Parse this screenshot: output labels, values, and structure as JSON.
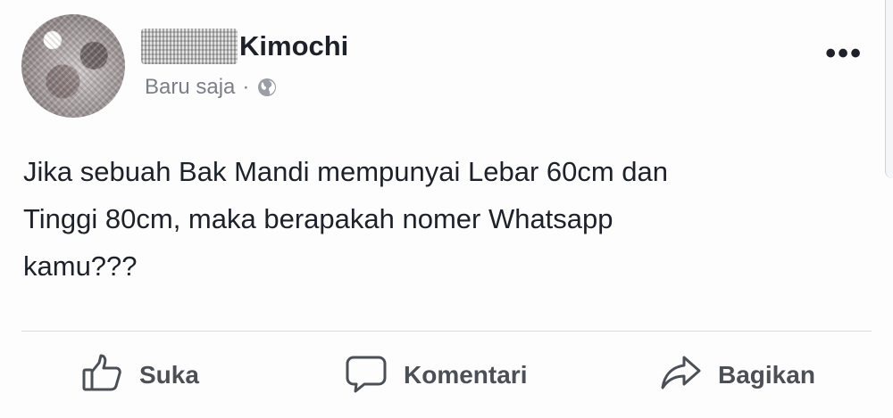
{
  "author": {
    "name": "Kimochi",
    "time": "Baru saja",
    "separator": "·",
    "privacy_icon": "globe-icon"
  },
  "menu": {
    "more_label": "•••"
  },
  "post": {
    "text": "Jika sebuah Bak Mandi mempunyai Lebar 60cm dan\nTinggi 80cm, maka berapakah nomer Whatsapp\nkamu???"
  },
  "actions": {
    "like": {
      "label": "Suka",
      "icon": "thumbs-up-icon"
    },
    "comment": {
      "label": "Komentari",
      "icon": "comment-icon"
    },
    "share": {
      "label": "Bagikan",
      "icon": "share-icon"
    }
  },
  "colors": {
    "text": "#1d2129",
    "meta": "#7b7f86",
    "action": "#4b4f56",
    "divider": "#d7d9dd"
  }
}
